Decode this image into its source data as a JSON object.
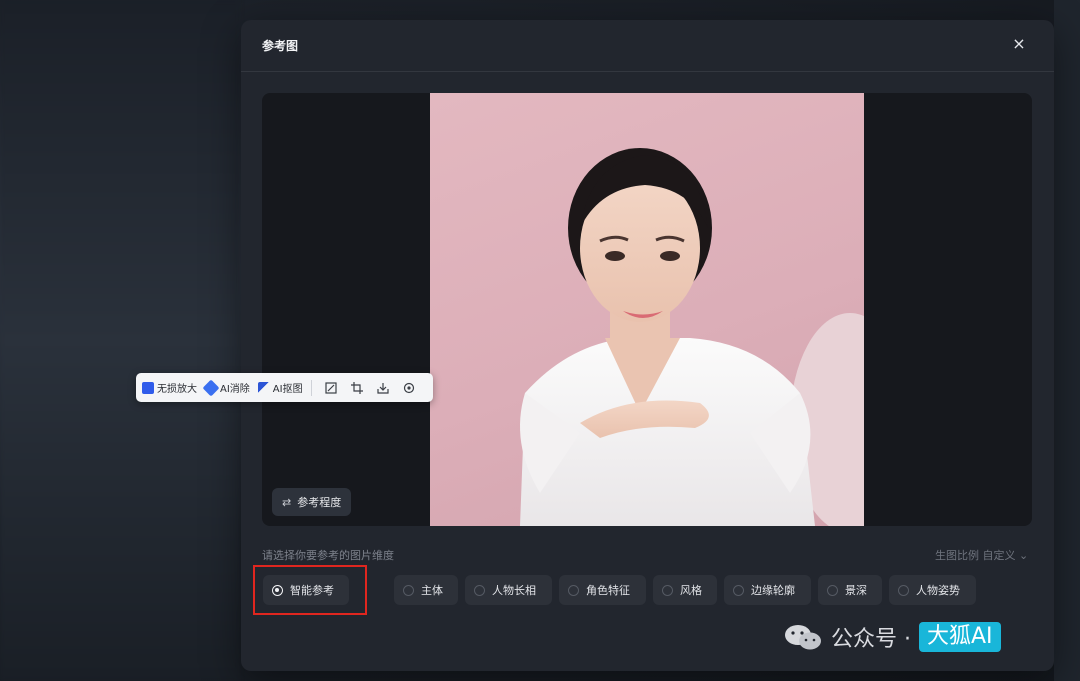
{
  "dialog": {
    "title": "参考图",
    "close_icon": "×"
  },
  "reference_button": {
    "label": "参考程度",
    "icon": "sliders-icon"
  },
  "toolbar": {
    "items": [
      {
        "label": "无损放大",
        "icon": "upscale-icon",
        "color": "#2f5bea"
      },
      {
        "label": "AI消除",
        "icon": "eraser-icon",
        "color": "#3a6ff0"
      },
      {
        "label": "AI抠图",
        "icon": "cutout-icon",
        "color": "#2c55d6"
      }
    ],
    "icon_buttons": [
      "edit-image-icon",
      "crop-icon",
      "download-icon",
      "settings-icon"
    ]
  },
  "dimension": {
    "prompt": "请选择你要参考的图片维度",
    "ratio_label": "生图比例 自定义 ⌄"
  },
  "options": [
    {
      "label": "智能参考",
      "selected": true
    },
    {
      "label": "主体",
      "selected": false
    },
    {
      "label": "人物长相",
      "selected": false
    },
    {
      "label": "角色特征",
      "selected": false
    },
    {
      "label": "风格",
      "selected": false
    },
    {
      "label": "边缘轮廓",
      "selected": false
    },
    {
      "label": "景深",
      "selected": false
    },
    {
      "label": "人物姿势",
      "selected": false
    }
  ],
  "watermark": {
    "text": "公众号 ·",
    "badge": "大狐AI"
  },
  "colors": {
    "accent": "#2bc1e6",
    "highlight": "#e0261f",
    "photo_bg": "#dcaeb8"
  }
}
